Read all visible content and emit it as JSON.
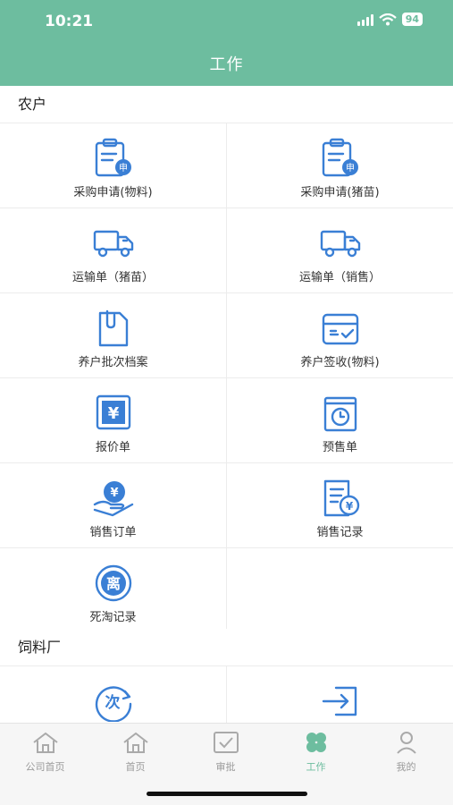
{
  "status": {
    "time": "10:21",
    "battery": "94"
  },
  "header": {
    "title": "工作"
  },
  "sections": [
    {
      "title": "农户",
      "items": [
        {
          "label": "采购申请(物料)",
          "icon": "clipboard-apply-icon"
        },
        {
          "label": "采购申请(猪苗)",
          "icon": "clipboard-apply-icon"
        },
        {
          "label": "运输单（猪苗）",
          "icon": "truck-icon"
        },
        {
          "label": "运输单（销售）",
          "icon": "truck-icon"
        },
        {
          "label": "养户批次档案",
          "icon": "file-clip-icon"
        },
        {
          "label": "养户签收(物料)",
          "icon": "box-check-icon"
        },
        {
          "label": "报价单",
          "icon": "yen-square-icon"
        },
        {
          "label": "预售单",
          "icon": "clock-doc-icon"
        },
        {
          "label": "销售订单",
          "icon": "yen-hand-icon"
        },
        {
          "label": "销售记录",
          "icon": "doc-yen-icon"
        },
        {
          "label": "死淘记录",
          "icon": "li-circle-icon"
        }
      ]
    },
    {
      "title": "饲料厂",
      "items": [
        {
          "label": "",
          "icon": "ci-circle-icon",
          "glyph": "次"
        },
        {
          "label": "",
          "icon": "login-box-icon"
        }
      ]
    }
  ],
  "icon_glyphs": {
    "yen": "¥",
    "apply": "申",
    "li": "离"
  },
  "tabs": [
    {
      "label": "公司首页",
      "icon": "home-icon",
      "active": false
    },
    {
      "label": "首页",
      "icon": "home-icon",
      "active": false
    },
    {
      "label": "审批",
      "icon": "check-square-icon",
      "active": false
    },
    {
      "label": "工作",
      "icon": "clover-icon",
      "active": true
    },
    {
      "label": "我的",
      "icon": "person-icon",
      "active": false
    }
  ],
  "colors": {
    "accent": "#6dbd9f",
    "icon_blue": "#3a7fd5"
  }
}
